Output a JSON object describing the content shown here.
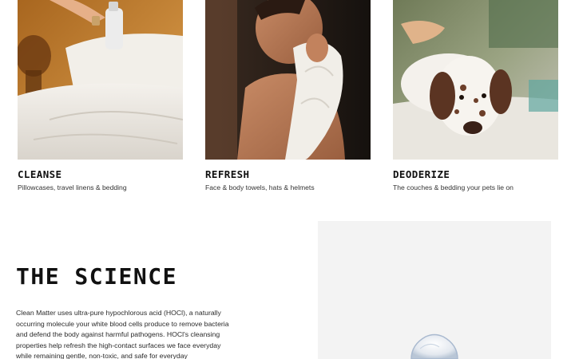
{
  "uses": [
    {
      "title": "CLEANSE",
      "subtitle": "Pillowcases, travel linens & bedding",
      "image": "hand-spraying-pillow-bedding"
    },
    {
      "title": "REFRESH",
      "subtitle": "Face & body towels, hats & helmets",
      "image": "man-drying-face-with-towel"
    },
    {
      "title": "DEODERIZE",
      "subtitle": "The couches & bedding your pets lie on",
      "image": "spotted-dog-on-couch"
    }
  ],
  "science": {
    "title": "THE SCIENCE",
    "body": "Clean Matter uses ultra-pure hypochlorous acid (HOCl), a naturally occurring molecule your white blood cells produce to remove bacteria and defend the body against harmful pathogens. HOCl's cleansing properties help refresh the high-contact surfaces we face everyday while remaining gentle, non-toxic, and safe for everyday",
    "image": "glass-bottle-product"
  },
  "colors": {
    "background": "#ffffff",
    "text": "#111111",
    "panel": "#f3f3f3"
  }
}
